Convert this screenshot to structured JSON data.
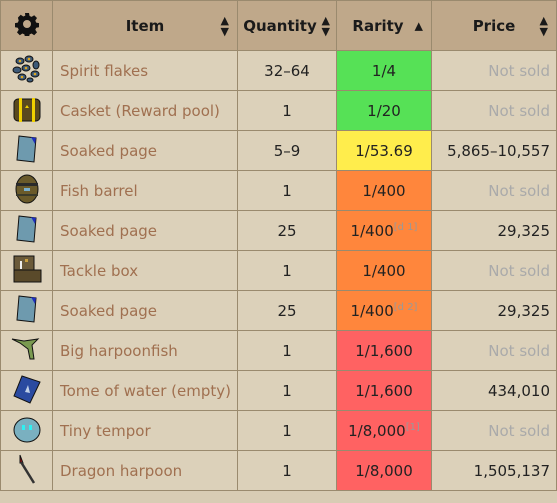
{
  "header": {
    "settings_icon": "gear-icon",
    "columns": [
      {
        "label": "Item",
        "sort": "both"
      },
      {
        "label": "Quantity",
        "sort": "both"
      },
      {
        "label": "Rarity",
        "sort": "ascending"
      },
      {
        "label": "Price",
        "sort": "both"
      }
    ]
  },
  "colors": {
    "green": "#56e156",
    "yellow": "#ffed4c",
    "orange": "#ff863c",
    "red": "#ff6262"
  },
  "rows": [
    {
      "icon": "spirit-flakes-icon",
      "item": "Spirit flakes",
      "quantity": "32–64",
      "rarity": "1/4",
      "note": "",
      "tier": "green",
      "price": "Not sold"
    },
    {
      "icon": "casket-icon",
      "item": "Casket (Reward pool)",
      "quantity": "1",
      "rarity": "1/20",
      "note": "",
      "tier": "green",
      "price": "Not sold"
    },
    {
      "icon": "soaked-page-icon",
      "item": "Soaked page",
      "quantity": "5–9",
      "rarity": "1/53.69",
      "note": "",
      "tier": "yellow",
      "price": "5,865–10,557"
    },
    {
      "icon": "fish-barrel-icon",
      "item": "Fish barrel",
      "quantity": "1",
      "rarity": "1/400",
      "note": "",
      "tier": "orange",
      "price": "Not sold"
    },
    {
      "icon": "soaked-page-icon",
      "item": "Soaked page",
      "quantity": "25",
      "rarity": "1/400",
      "note": "[d 1]",
      "tier": "orange",
      "price": "29,325"
    },
    {
      "icon": "tackle-box-icon",
      "item": "Tackle box",
      "quantity": "1",
      "rarity": "1/400",
      "note": "",
      "tier": "orange",
      "price": "Not sold"
    },
    {
      "icon": "soaked-page-icon",
      "item": "Soaked page",
      "quantity": "25",
      "rarity": "1/400",
      "note": "[d 2]",
      "tier": "orange",
      "price": "29,325"
    },
    {
      "icon": "big-harpoonfish-icon",
      "item": "Big harpoonfish",
      "quantity": "1",
      "rarity": "1/1,600",
      "note": "",
      "tier": "red",
      "price": "Not sold"
    },
    {
      "icon": "tome-of-water-icon",
      "item": "Tome of water (empty)",
      "quantity": "1",
      "rarity": "1/1,600",
      "note": "",
      "tier": "red",
      "price": "434,010"
    },
    {
      "icon": "tiny-tempor-icon",
      "item": "Tiny tempor",
      "quantity": "1",
      "rarity": "1/8,000",
      "note": "[1]",
      "tier": "red",
      "price": "Not sold"
    },
    {
      "icon": "dragon-harpoon-icon",
      "item": "Dragon harpoon",
      "quantity": "1",
      "rarity": "1/8,000",
      "note": "",
      "tier": "red",
      "price": "1,505,137"
    }
  ]
}
